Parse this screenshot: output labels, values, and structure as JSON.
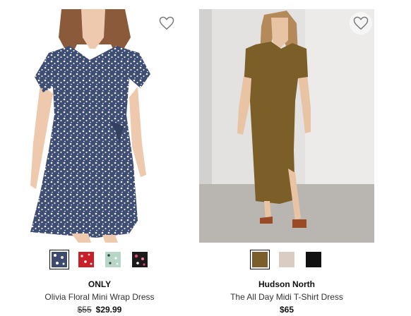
{
  "products": [
    {
      "brand": "ONLY",
      "name": "Olivia Floral Mini Wrap Dress",
      "original_price": "$55",
      "price": "$29.99",
      "favorite_icon": "heart-outline-icon",
      "swatches": [
        {
          "label": "navy-floral",
          "color": "#3c4a6e",
          "selected": true
        },
        {
          "label": "red-floral",
          "color": "#c8202a",
          "selected": false
        },
        {
          "label": "mint-floral",
          "color": "#b6d6c8",
          "selected": false
        },
        {
          "label": "black-pink-floral",
          "color": "#1a1a1a",
          "selected": false
        }
      ]
    },
    {
      "brand": "Hudson North",
      "name": "The All Day Midi T-Shirt Dress",
      "original_price": "",
      "price": "$65",
      "favorite_icon": "heart-outline-icon",
      "swatches": [
        {
          "label": "olive",
          "color": "#7a5f2a",
          "selected": true
        },
        {
          "label": "oatmeal",
          "color": "#d9cdc3",
          "selected": false
        },
        {
          "label": "black",
          "color": "#111111",
          "selected": false
        }
      ]
    }
  ]
}
